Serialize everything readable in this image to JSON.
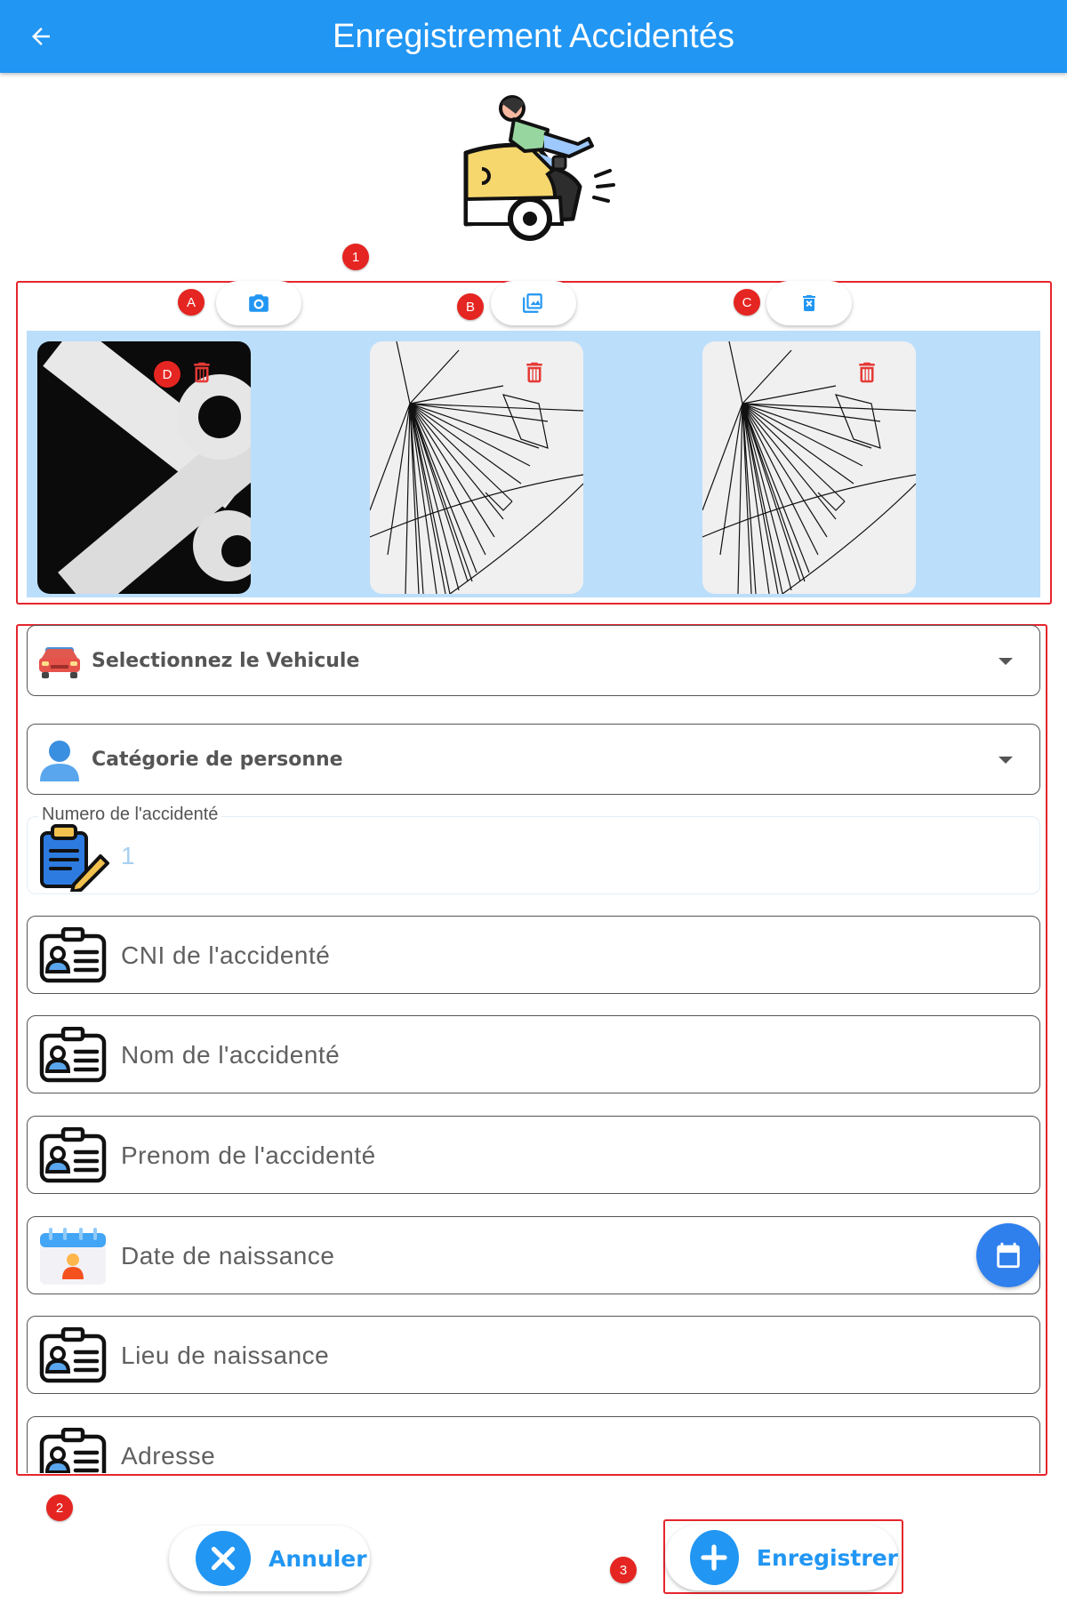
{
  "appbar": {
    "title": "Enregistrement Accidentés",
    "back_icon": "arrow-left-icon"
  },
  "hero": {
    "icon": "pedestrian-hit-by-car-icon"
  },
  "markers": {
    "m1": "1",
    "m2": "2",
    "m3": "3",
    "mA": "A",
    "mB": "B",
    "mC": "C",
    "mD": "D"
  },
  "photo_toolbar": {
    "camera_icon": "camera-icon",
    "gallery_icon": "image-gallery-icon",
    "clear_icon": "delete-all-icon"
  },
  "gallery": {
    "thumbnails": [
      "scissors-photo",
      "line-drawing-photo",
      "line-drawing-photo"
    ],
    "delete_icon": "trash-icon"
  },
  "form": {
    "vehicle_select": "Selectionnez le Vehicule",
    "person_category_select": "Catégorie de personne",
    "accident_number_label": "Numero de l'accidenté",
    "accident_number_value": "1",
    "cni_placeholder": "CNI de l'accidenté",
    "nom_placeholder": "Nom de l'accidenté",
    "prenom_placeholder": "Prenom de l'accidenté",
    "date_naissance_placeholder": "Date de naissance",
    "lieu_naissance_placeholder": "Lieu de naissance",
    "adresse_placeholder": "Adresse"
  },
  "actions": {
    "cancel": "Annuler",
    "save": "Enregistrer"
  },
  "colors": {
    "primary": "#2196f3",
    "marker_red": "#e52521",
    "gallery_bg": "#bbdefb",
    "trash_red": "#e53935"
  }
}
